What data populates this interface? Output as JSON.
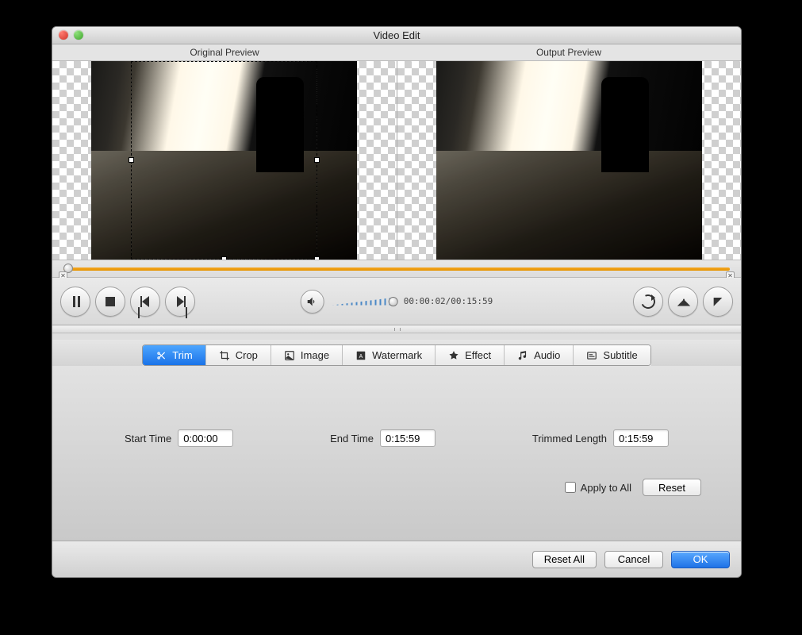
{
  "window": {
    "title": "Video Edit"
  },
  "previews": {
    "original_label": "Original Preview",
    "output_label": "Output Preview"
  },
  "timeline": {
    "left_marker": "✕",
    "right_marker": "✕"
  },
  "playback": {
    "current_time": "00:00:02",
    "total_time": "00:15:59",
    "time_display": "00:00:02/00:15:59"
  },
  "tabs": {
    "trim": "Trim",
    "crop": "Crop",
    "image": "Image",
    "watermark": "Watermark",
    "effect": "Effect",
    "audio": "Audio",
    "subtitle": "Subtitle"
  },
  "trim": {
    "start_label": "Start Time",
    "start_value": "0:00:00",
    "end_label": "End Time",
    "end_value": "0:15:59",
    "length_label": "Trimmed Length",
    "length_value": "0:15:59"
  },
  "panel": {
    "apply_all_label": "Apply to All",
    "apply_all_checked": false,
    "reset_label": "Reset"
  },
  "footer": {
    "reset_all": "Reset All",
    "cancel": "Cancel",
    "ok": "OK"
  }
}
